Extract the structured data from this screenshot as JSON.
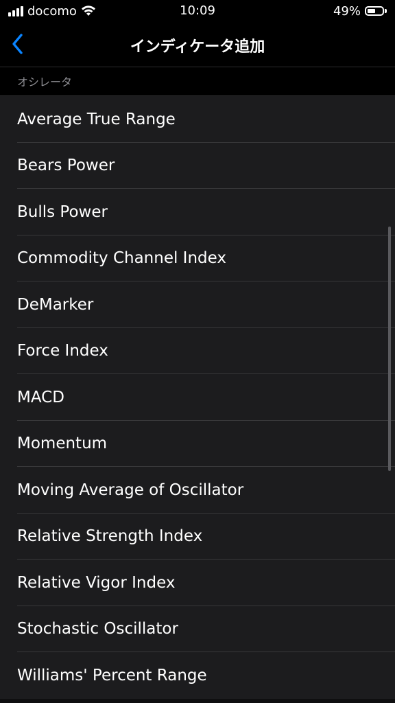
{
  "status_bar": {
    "carrier": "docomo",
    "time": "10:09",
    "battery_percent": "49%",
    "battery_level": 0.49,
    "signal_bars": 4,
    "icons": [
      "signal-icon",
      "wifi-icon",
      "battery-icon"
    ]
  },
  "nav": {
    "title": "インディケータ追加",
    "back_icon": "chevron-left-icon",
    "accent_color": "#0a84ff"
  },
  "section": {
    "header": "オシレータ"
  },
  "indicators": [
    {
      "label": "Average True Range"
    },
    {
      "label": "Bears Power"
    },
    {
      "label": "Bulls Power"
    },
    {
      "label": "Commodity Channel Index"
    },
    {
      "label": "DeMarker"
    },
    {
      "label": "Force Index"
    },
    {
      "label": "MACD"
    },
    {
      "label": "Momentum"
    },
    {
      "label": "Moving Average of Oscillator"
    },
    {
      "label": "Relative Strength Index"
    },
    {
      "label": "Relative Vigor Index"
    },
    {
      "label": "Stochastic Oscillator"
    },
    {
      "label": "Williams' Percent Range"
    }
  ],
  "colors": {
    "background": "#000000",
    "list_background": "#1c1c1e",
    "separator": "#38383a",
    "secondary_text": "#8e8e93"
  }
}
